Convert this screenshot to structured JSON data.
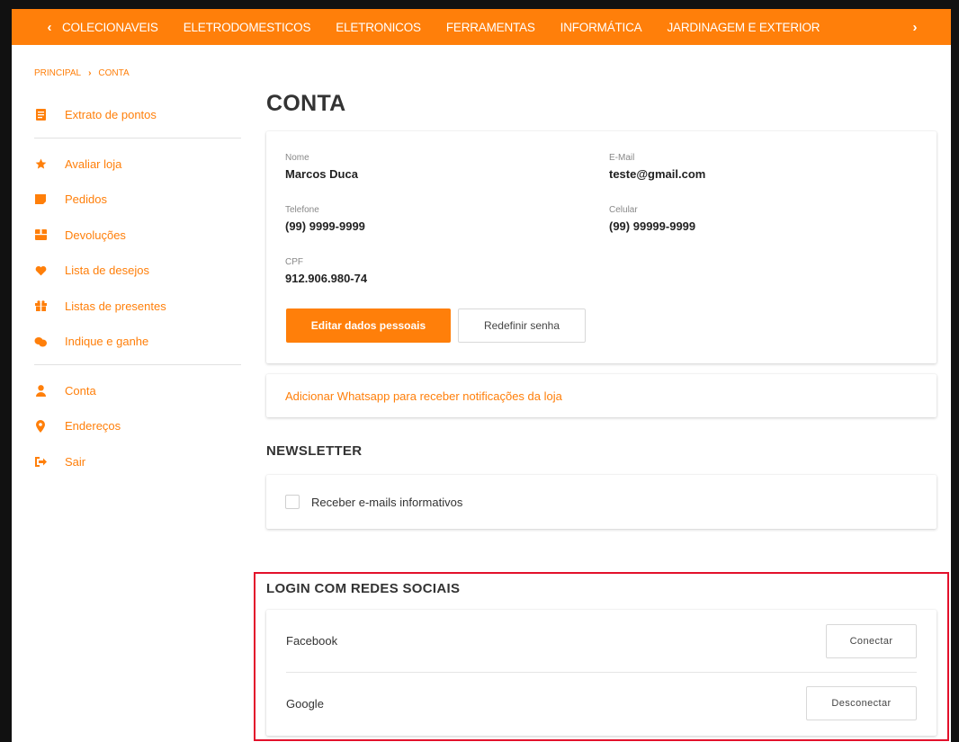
{
  "topnav": {
    "prev_arrow": "‹",
    "next_arrow": "›",
    "categories": [
      "COLECIONAVEIS",
      "ELETRODOMESTICOS",
      "ELETRONICOS",
      "FERRAMENTAS",
      "INFORMÁTICA",
      "JARDINAGEM E EXTERIOR"
    ]
  },
  "breadcrumb": {
    "home": "PRINCIPAL",
    "separator": "›",
    "current": "CONTA"
  },
  "sidebar": {
    "items": [
      {
        "label": "Extrato de pontos",
        "icon": "receipt-icon"
      },
      {
        "label": "Avaliar loja",
        "icon": "star-icon"
      },
      {
        "label": "Pedidos",
        "icon": "order-icon"
      },
      {
        "label": "Devoluções",
        "icon": "box-icon"
      },
      {
        "label": "Lista de desejos",
        "icon": "heart-icon"
      },
      {
        "label": "Listas de presentes",
        "icon": "gift-icon"
      },
      {
        "label": "Indique e ganhe",
        "icon": "handshake-icon"
      },
      {
        "label": "Conta",
        "icon": "user-icon"
      },
      {
        "label": "Endereços",
        "icon": "map-pin-icon"
      },
      {
        "label": "Sair",
        "icon": "sign-out-icon"
      }
    ]
  },
  "page": {
    "title": "CONTA"
  },
  "account": {
    "nome_label": "Nome",
    "nome": "Marcos Duca",
    "email_label": "E-Mail",
    "email": "teste@gmail.com",
    "telefone_label": "Telefone",
    "telefone": "(99) 9999-9999",
    "celular_label": "Celular",
    "celular": "(99) 99999-9999",
    "cpf_label": "CPF",
    "cpf": "912.906.980-74",
    "edit_button": "Editar dados pessoais",
    "reset_button": "Redefinir senha"
  },
  "whatsapp": {
    "link": "Adicionar Whatsapp para receber notificações da loja"
  },
  "newsletter": {
    "title": "NEWSLETTER",
    "checkbox_label": "Receber e-mails informativos",
    "checked": false
  },
  "social": {
    "title": "LOGIN COM REDES SOCIAIS",
    "providers": [
      {
        "name": "Facebook",
        "action": "Conectar"
      },
      {
        "name": "Google",
        "action": "Desconectar"
      }
    ]
  },
  "colors": {
    "accent": "#ff7f0a",
    "highlight": "#e3102b"
  }
}
